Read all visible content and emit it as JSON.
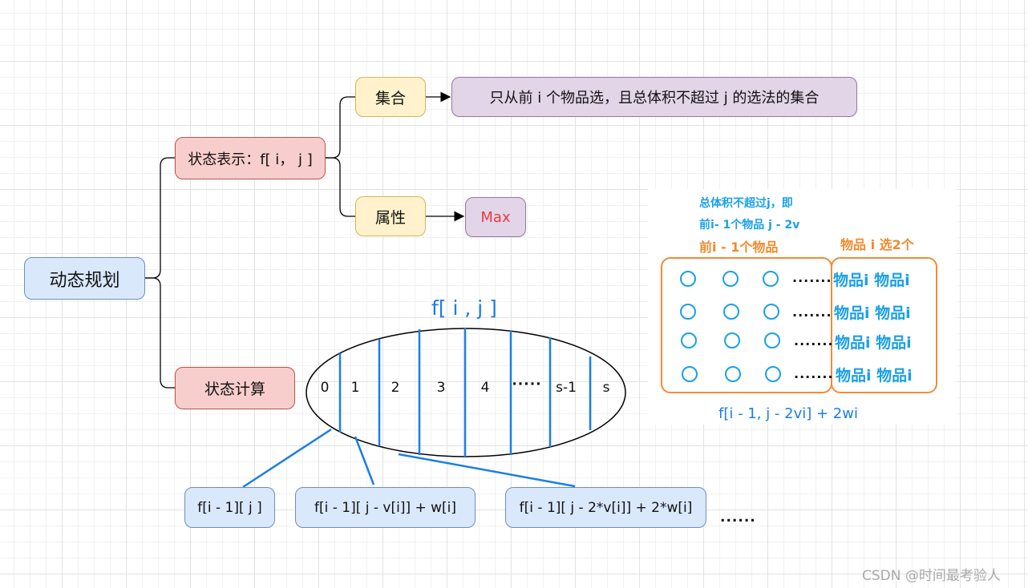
{
  "root": {
    "label": "动态规划"
  },
  "state_representation": {
    "label": "状态表示：f[ i， j ]",
    "set": {
      "label": "集合",
      "description": "只从前 i 个物品选，且总体积不超过 j 的选法的集合"
    },
    "attribute": {
      "label": "属性",
      "value": "Max"
    }
  },
  "state_computation": {
    "label": "状态计算",
    "title": "f[ i , j ]",
    "partitions": [
      "0",
      "1",
      "2",
      "3",
      "4",
      "·····",
      "s-1",
      "s"
    ],
    "transitions": [
      "f[i - 1][ j ]",
      "f[i - 1][ j - v[i]] + w[i]",
      "f[i - 1][ j - 2*v[i]] + 2*w[i]"
    ],
    "more": "......"
  },
  "inset": {
    "line1": "总体积不超过j，即",
    "line2": "前i- 1个物品 j - 2v",
    "line3": "前i - 1个物品",
    "line4": "物品 i 选2个",
    "dots": ".......",
    "item_label": "物品i 物品i",
    "formula": "f[i - 1, j - 2vi]   + 2wi"
  },
  "watermark": "CSDN @时间最考验人",
  "colors": {
    "blue_fill": "#dae8fc",
    "red_fill": "#f8cecc",
    "yellow_fill": "#fff2cc",
    "purple_fill": "#e1d5e7",
    "accent_blue": "#1a7ee6",
    "max_red": "#e83a44",
    "orange": "#f58a35",
    "light_blue": "#1aa0e8"
  }
}
